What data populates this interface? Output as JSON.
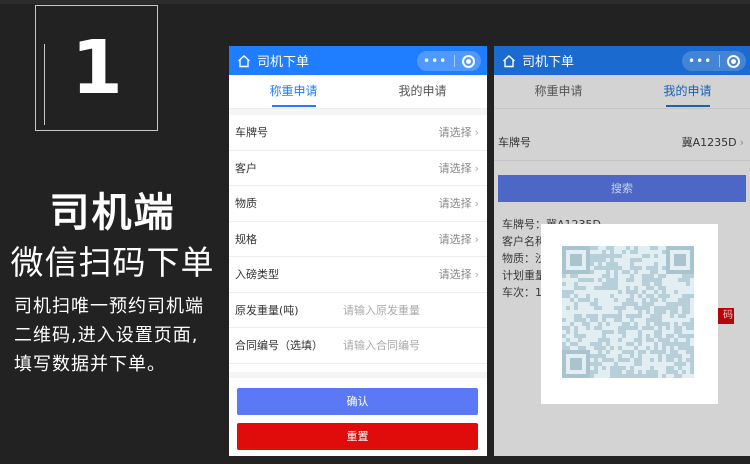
{
  "intro": {
    "step_number": "1",
    "heading": "司机端",
    "subheading": "微信扫码下单",
    "description_lines": [
      "司机扫唯一预约司机端",
      "二维码,进入设置页面,",
      "填写数据并下单。"
    ]
  },
  "phone1": {
    "title": "司机下单",
    "capsule_dots": "•••",
    "tabs": [
      {
        "label": "称重申请",
        "active": true
      },
      {
        "label": "我的申请",
        "active": false
      }
    ],
    "rows": [
      {
        "label": "车牌号",
        "value": "请选择"
      },
      {
        "label": "客户",
        "value": "请选择"
      },
      {
        "label": "物质",
        "value": "请选择"
      },
      {
        "label": "规格",
        "value": "请选择"
      },
      {
        "label": "入磅类型",
        "value": "请选择"
      }
    ],
    "inputs": [
      {
        "label": "原发重量(吨)",
        "placeholder": "请输入原发重量"
      },
      {
        "label": "合同编号（选填）",
        "placeholder": "请输入合同编号"
      }
    ],
    "confirm_label": "确认",
    "reset_label": "重置"
  },
  "phone2": {
    "title": "司机下单",
    "capsule_dots": "•••",
    "tabs": [
      {
        "label": "称重申请",
        "active": false
      },
      {
        "label": "我的申请",
        "active": true
      }
    ],
    "plate_label": "车牌号",
    "plate_value": "冀A1235D",
    "search_label": "搜索",
    "info_lines": [
      "车牌号：冀A1235D",
      "客户名称",
      "物质：沙",
      "计划重量",
      "车次：1"
    ],
    "red_tag": "码"
  },
  "colors": {
    "brand_blue": "#1f7eff",
    "confirm_blue": "#5b79f6",
    "reset_red": "#e00b0b",
    "background": "#222222"
  }
}
